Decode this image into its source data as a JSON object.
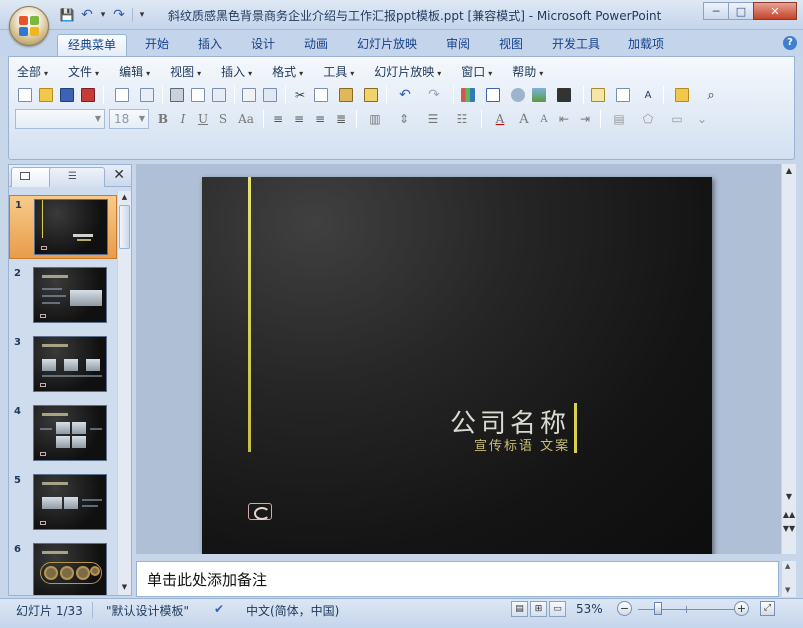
{
  "window": {
    "title": "斜纹质感黑色背景商务企业介绍与工作汇报ppt模板.ppt [兼容模式] - Microsoft PowerPoint",
    "minimize": "─",
    "maximize": "□",
    "close": "✕"
  },
  "quick_access": {
    "save_icon": "💾",
    "undo_icon": "↶",
    "dropdown": "▾",
    "redo_icon": "↷",
    "customize": "▾"
  },
  "ribbon_tabs": [
    {
      "label": "经典菜单",
      "active": true
    },
    {
      "label": "开始",
      "active": false
    },
    {
      "label": "插入",
      "active": false
    },
    {
      "label": "设计",
      "active": false
    },
    {
      "label": "动画",
      "active": false
    },
    {
      "label": "幻灯片放映",
      "active": false
    },
    {
      "label": "审阅",
      "active": false
    },
    {
      "label": "视图",
      "active": false
    },
    {
      "label": "开发工具",
      "active": false
    },
    {
      "label": "加载项",
      "active": false
    }
  ],
  "help_label": "?",
  "classic_menu": [
    {
      "label": "全部"
    },
    {
      "label": "文件"
    },
    {
      "label": "编辑"
    },
    {
      "label": "视图"
    },
    {
      "label": "插入"
    },
    {
      "label": "格式"
    },
    {
      "label": "工具"
    },
    {
      "label": "幻灯片放映"
    },
    {
      "label": "窗口"
    },
    {
      "label": "帮助"
    }
  ],
  "menu_arrow": "▾",
  "format_bar": {
    "font_name": "",
    "font_size": "18",
    "bold": "B",
    "italic": "I",
    "underline": "U",
    "shadow": "S",
    "change_case": "Aa",
    "font_color": "A",
    "grow_font": "A",
    "shrink_font": "A"
  },
  "left_pane": {
    "close_label": "✕",
    "slides": [
      {
        "num": "1",
        "selected": true
      },
      {
        "num": "2",
        "selected": false
      },
      {
        "num": "3",
        "selected": false
      },
      {
        "num": "4",
        "selected": false
      },
      {
        "num": "5",
        "selected": false
      },
      {
        "num": "6",
        "selected": false
      }
    ]
  },
  "slide": {
    "company_name": "公司名称",
    "slogan": "宣传标语 文案",
    "accent_color": "#d8d050"
  },
  "notes": {
    "placeholder": "单击此处添加备注"
  },
  "status_bar": {
    "slide_count": "幻灯片 1/33",
    "theme": "\"默认设计模板\"",
    "language": "中文(简体，中国)",
    "zoom": "53%",
    "zoom_minus": "−",
    "zoom_plus": "+"
  }
}
